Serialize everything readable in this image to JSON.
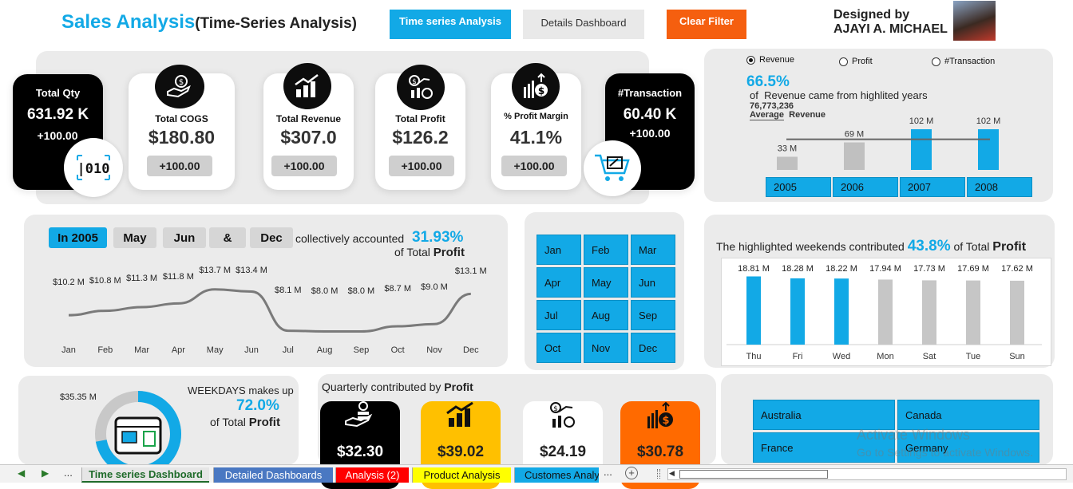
{
  "header": {
    "title": "Sales Analysis",
    "subtitle": "(Time-Series Analysis)",
    "btn_timeseries": "Time series Analysis",
    "btn_details": "Details Dashboard",
    "btn_clear": "Clear Filter",
    "designed_by": "Designed by",
    "designer_name": "AJAYI A. MICHAEL",
    "colors": {
      "accent": "#12a9e6",
      "clear": "#f55f0f"
    }
  },
  "kpis": {
    "qty": {
      "label": "Total Qty",
      "value": "631.92 K",
      "delta": "+100.00"
    },
    "cogs": {
      "label": "Total COGS",
      "value": "$180.80",
      "delta": "+100.00",
      "icon": "money-hand-icon"
    },
    "revenue": {
      "label": "Total Revenue",
      "value": "$307.0",
      "delta": "+100.00",
      "icon": "growth-bars-icon"
    },
    "profit": {
      "label": "Total Profit",
      "value": "$126.2",
      "delta": "+100.00",
      "icon": "profit-coin-icon"
    },
    "margin": {
      "label": "% Profit Margin",
      "value": "41.1%",
      "delta": "+100.00",
      "icon": "dollar-up-icon"
    },
    "transaction": {
      "label": "#Transaction",
      "value": "60.40 K",
      "delta": "+100.00",
      "icon": "cart-icon"
    }
  },
  "year_panel": {
    "radios": [
      "Revenue",
      "Profit",
      "#Transaction"
    ],
    "selected": "Revenue",
    "pct": "66.5%",
    "pct_text_pre": "of",
    "pct_text": "Revenue came from highlited years",
    "avg_value": "76,773,236",
    "avg_label": "Average",
    "avg_metric": "Revenue",
    "slicers": [
      "2005",
      "2006",
      "2007",
      "2008"
    ]
  },
  "month_panel": {
    "chips": [
      "In 2005",
      "May",
      "Jun",
      "&",
      "Dec"
    ],
    "text1": "collectively accounted",
    "pct": "31.93%",
    "text2": "of Total",
    "metric": "Profit"
  },
  "month_slicer": [
    "Jan",
    "Feb",
    "Mar",
    "Apr",
    "May",
    "Jun",
    "Jul",
    "Aug",
    "Sep",
    "Oct",
    "Nov",
    "Dec"
  ],
  "weekend_panel": {
    "text1": "The highlighted weekends contributed",
    "pct": "43.8%",
    "text2": "of Total",
    "metric": "Profit"
  },
  "weekday_panel": {
    "label_value": "$35.35 M",
    "text1": "WEEKDAYS makes up",
    "pct": "72.0%",
    "text2": "of Total",
    "metric": "Profit",
    "share": 0.72
  },
  "quarter_panel": {
    "title": "Quarterly contributed by",
    "metric": "Profit",
    "cards": [
      {
        "value": "$32.30",
        "icon": "hand-coins-icon",
        "bg": "#000000",
        "fg": "#ffffff"
      },
      {
        "value": "$39.02",
        "icon": "growth-bars-icon",
        "bg": "#ffc000",
        "fg": "#222222"
      },
      {
        "value": "$24.19",
        "icon": "profit-coin-icon",
        "bg": "#ffffff",
        "fg": "#222222"
      },
      {
        "value": "$30.78",
        "icon": "dollar-up-icon",
        "bg": "#ff6a00",
        "fg": "#222222"
      }
    ]
  },
  "country_slicer": [
    "Australia",
    "Canada",
    "France",
    "Germany"
  ],
  "watermark": {
    "line1": "Activate Windows",
    "line2": "Go to Settings to activate Windows."
  },
  "tabs": {
    "nav_dots": "...",
    "nav_dots2": "...",
    "items": [
      {
        "label": "Time series Dashboard",
        "color": "#e6e6e6"
      },
      {
        "label": "Detailed Dashboards",
        "color": "#4a78c2"
      },
      {
        "label": "Analysis (2)",
        "color": "#ff0000"
      },
      {
        "label": "Product Analysis",
        "color": "#ffff00"
      },
      {
        "label": "Customes Analy",
        "color": "#12a9e6"
      }
    ]
  },
  "chart_data": [
    {
      "type": "bar",
      "categories": [
        "2005",
        "2006",
        "2007",
        "2008"
      ],
      "values": [
        33,
        69,
        102,
        102
      ],
      "labels": [
        "33 M",
        "69 M",
        "102 M",
        "102 M"
      ],
      "highlighted": [
        false,
        false,
        true,
        true
      ],
      "unit": "M",
      "ylim": [
        0,
        110
      ],
      "average_line": 76.77
    },
    {
      "type": "line",
      "categories": [
        "Jan",
        "Feb",
        "Mar",
        "Apr",
        "May",
        "Jun",
        "Jul",
        "Aug",
        "Sep",
        "Oct",
        "Nov",
        "Dec"
      ],
      "values": [
        10.2,
        10.8,
        11.3,
        11.8,
        13.7,
        13.4,
        8.1,
        8.0,
        8.0,
        8.7,
        9.0,
        13.1
      ],
      "labels": [
        "$10.2 M",
        "$10.8 M",
        "$11.3 M",
        "$11.8 M",
        "$13.7 M",
        "$13.4 M",
        "$8.1 M",
        "$8.0 M",
        "$8.0 M",
        "$8.7 M",
        "$9.0 M",
        "$13.1 M"
      ],
      "ylim": [
        0,
        16
      ]
    },
    {
      "type": "bar",
      "categories": [
        "Thu",
        "Fri",
        "Wed",
        "Mon",
        "Sat",
        "Tue",
        "Sun"
      ],
      "values": [
        18.81,
        18.28,
        18.22,
        17.94,
        17.73,
        17.69,
        17.62
      ],
      "labels": [
        "18.81 M",
        "18.28 M",
        "18.22 M",
        "17.94 M",
        "17.73 M",
        "17.69 M",
        "17.62 M"
      ],
      "highlighted": [
        true,
        true,
        true,
        false,
        false,
        false,
        false
      ],
      "ylim": [
        0,
        22
      ]
    }
  ]
}
